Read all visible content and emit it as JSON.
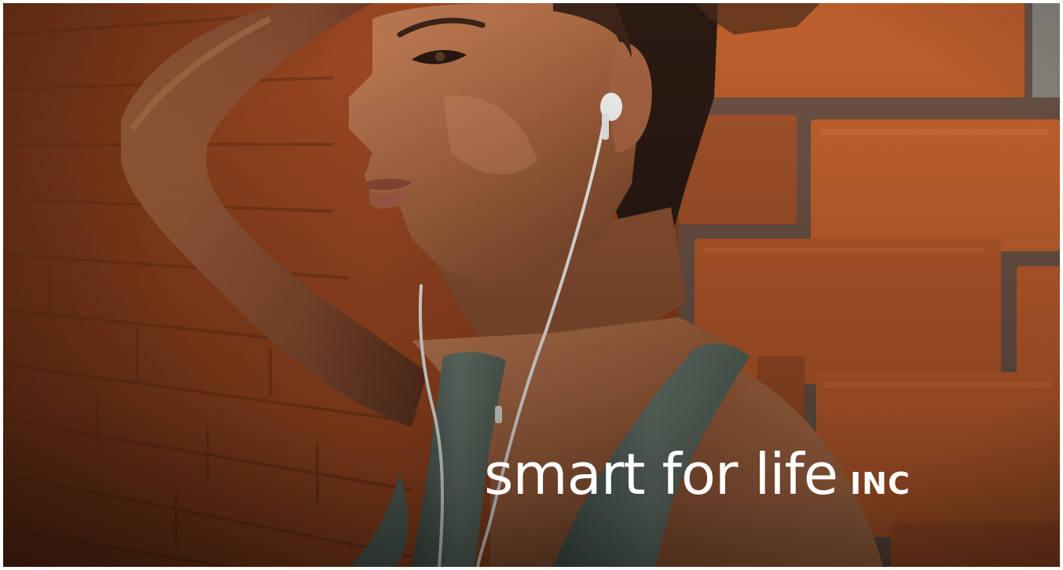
{
  "logo": {
    "wordmark": "smart for life",
    "suffix": "INC"
  },
  "colors": {
    "logo_text": "#ffffff",
    "brick": "#b55a2c",
    "mortar": "#5e4a3e",
    "skin": "#b0714a",
    "tank_top": "#5c6a60",
    "earbud": "#f1f1ef"
  },
  "icons": {
    "hero_photo": "woman-with-earbuds-by-brick-wall-photo"
  }
}
